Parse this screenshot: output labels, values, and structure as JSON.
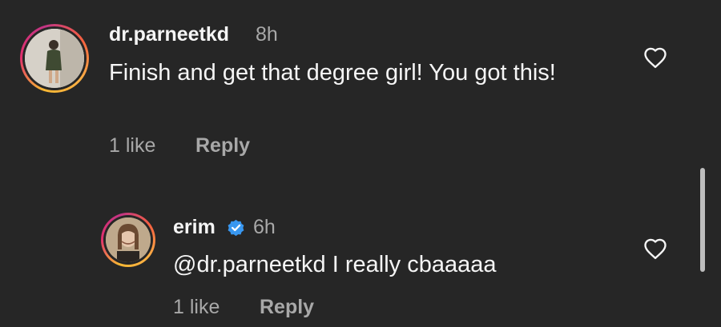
{
  "comments": [
    {
      "username": "dr.parneetkd",
      "time": "8h",
      "text": "Finish and get that degree girl! You got this!",
      "likes": "1 like",
      "reply_label": "Reply"
    },
    {
      "username": "erim",
      "time": "6h",
      "text": "@dr.parneetkd I really cbaaaaa",
      "likes": "1 like",
      "reply_label": "Reply",
      "verified": true
    }
  ],
  "icons": {
    "like": "heart-outline-icon",
    "verified": "verified-badge-icon"
  },
  "colors": {
    "background": "#262626",
    "primary_text": "#f5f5f5",
    "secondary_text": "#a8a8a8",
    "verified_blue": "#3897f0"
  }
}
